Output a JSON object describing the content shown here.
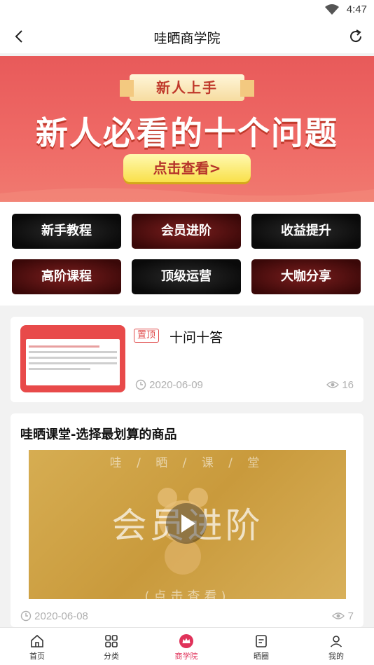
{
  "status_bar": {
    "time": "4:47"
  },
  "nav": {
    "title": "哇晒商学院"
  },
  "banner": {
    "ribbon": "新人上手",
    "headline": "新人必看的十个问题",
    "cta": "点击查看>"
  },
  "grid": [
    {
      "label": "新手教程"
    },
    {
      "label": "会员进阶"
    },
    {
      "label": "收益提升"
    },
    {
      "label": "高阶课程"
    },
    {
      "label": "顶级运营"
    },
    {
      "label": "大咖分享"
    }
  ],
  "article1": {
    "badge": "置顶",
    "title": "十问十答",
    "date": "2020-06-09",
    "views": "16"
  },
  "article2": {
    "title": "哇晒课堂-选择最划算的商品",
    "video_sub": "哇 / 晒 / 课 / 堂",
    "video_title": "会员进阶",
    "video_bottom": "(点击查看)",
    "date": "2020-06-08",
    "views": "7"
  },
  "tabbar": [
    {
      "label": "首页",
      "icon": "home-icon"
    },
    {
      "label": "分类",
      "icon": "grid-icon"
    },
    {
      "label": "商学院",
      "icon": "crown-icon"
    },
    {
      "label": "晒圈",
      "icon": "document-icon"
    },
    {
      "label": "我的",
      "icon": "person-icon"
    }
  ],
  "colors": {
    "accent": "#e0325a",
    "banner": "#ec6460"
  }
}
